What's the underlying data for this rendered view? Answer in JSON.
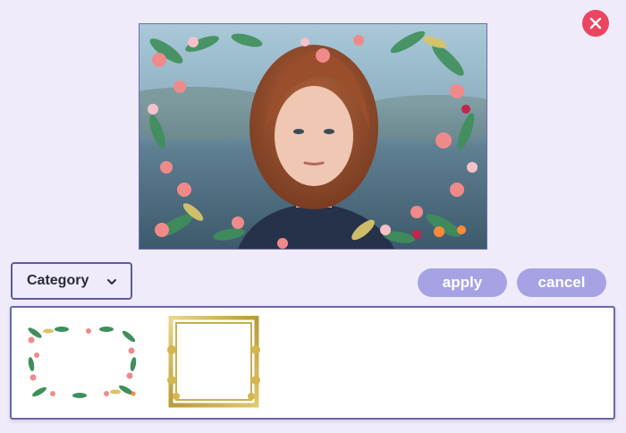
{
  "dialog": {
    "close_icon": "close-icon",
    "close_color": "#ec4561"
  },
  "preview": {
    "frame": "floral-frame",
    "subject": "portrait-photo"
  },
  "category_select": {
    "selected": "Category",
    "icon": "chevron-down-icon"
  },
  "actions": {
    "apply_label": "apply",
    "cancel_label": "cancel",
    "button_color": "#a6a2e4"
  },
  "frames": {
    "items": [
      {
        "name": "floral-frame",
        "icon": "floral-frame-thumbnail"
      },
      {
        "name": "gold-frame",
        "icon": "gold-frame-thumbnail"
      }
    ]
  },
  "colors": {
    "background": "#efebfb",
    "accent_border": "#5d5a9f"
  }
}
